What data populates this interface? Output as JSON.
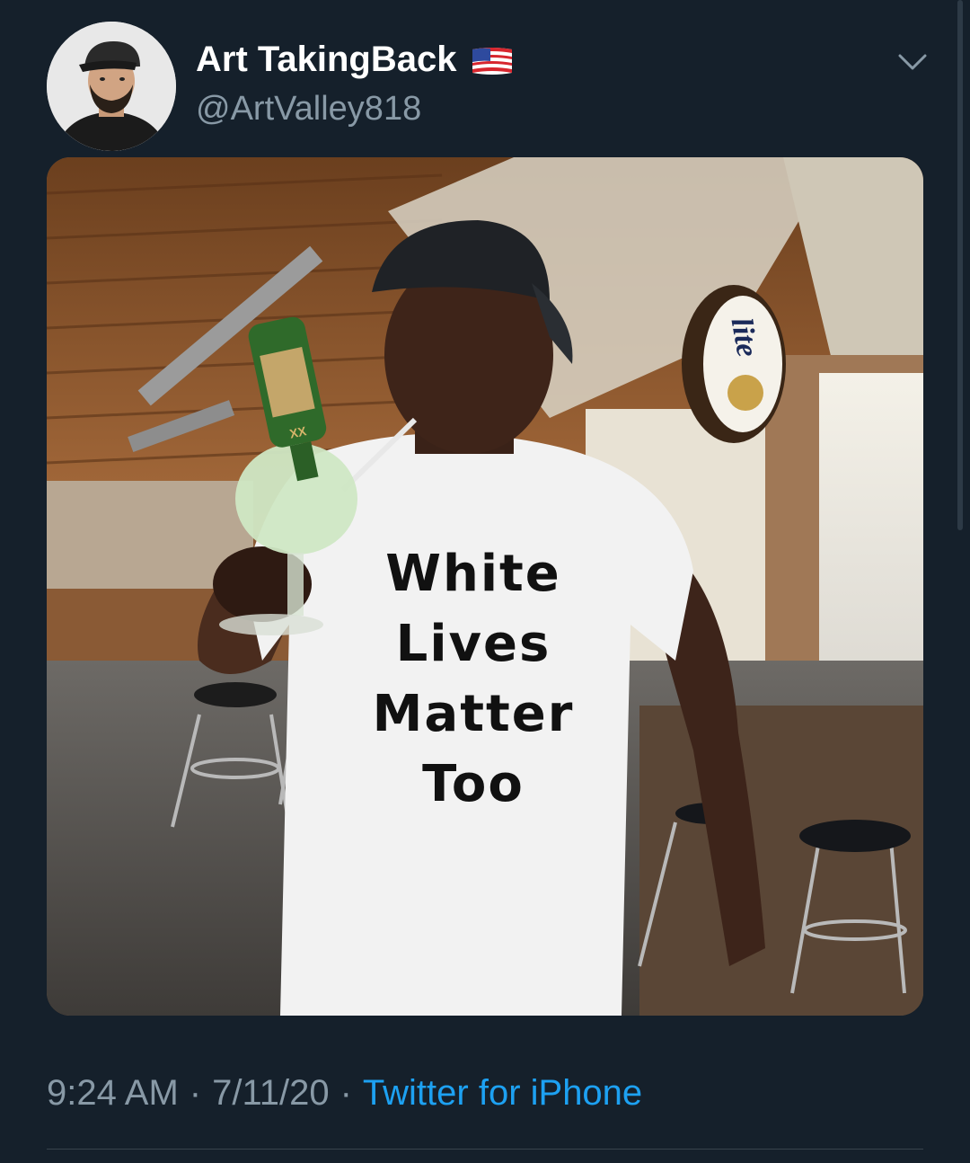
{
  "author": {
    "display_name": "Art TakingBack",
    "handle": "@ArtValley818",
    "flag_icon": "us-flag-icon"
  },
  "media": {
    "shirt_lines": [
      "White",
      "Lives",
      "Matter",
      "Too"
    ],
    "bottle_label": "XX",
    "sign_text": "lite"
  },
  "meta": {
    "time": "9:24 AM",
    "separator": "·",
    "date": "7/11/20",
    "source": "Twitter for iPhone"
  },
  "colors": {
    "background": "#15202b",
    "secondary_text": "#8899a6",
    "link": "#1da1f2"
  }
}
